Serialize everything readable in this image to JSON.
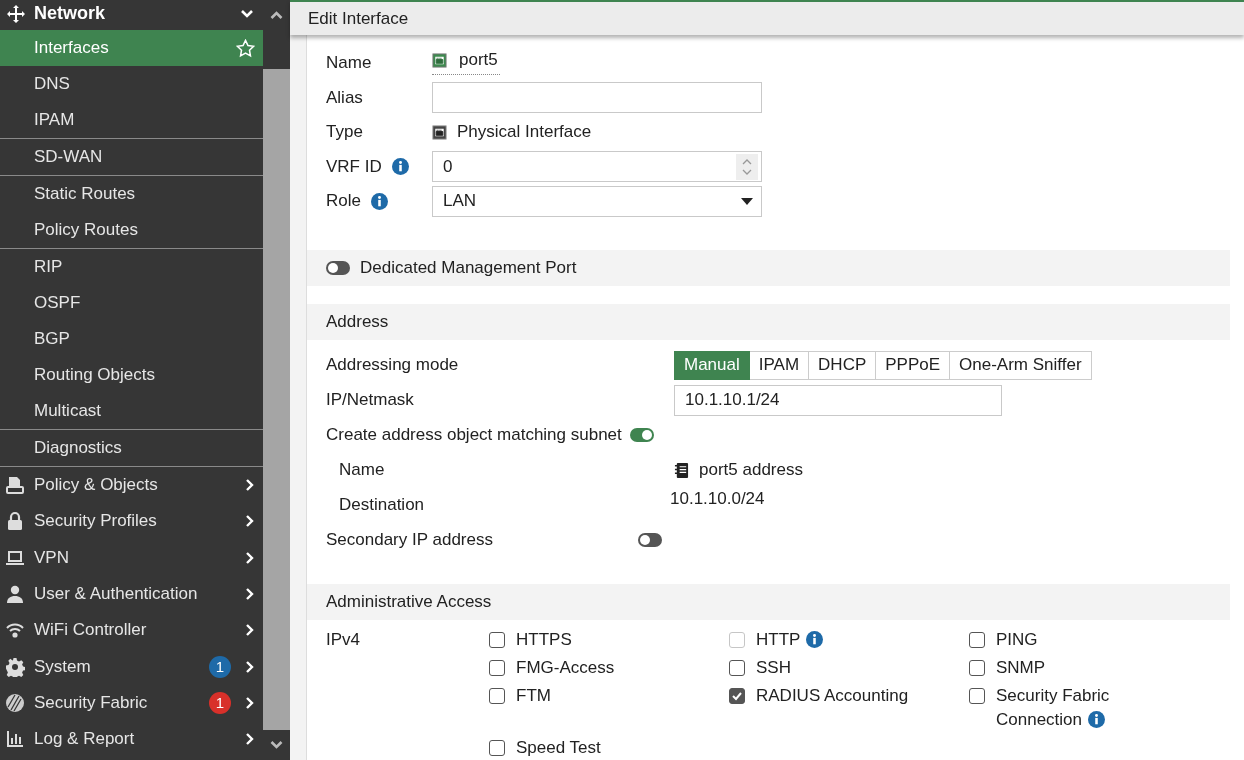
{
  "sidebar": {
    "header": {
      "label": "Network",
      "expanded": true
    },
    "groups": [
      [
        {
          "label": "Interfaces",
          "selected": true
        },
        {
          "label": "DNS",
          "selected": false
        },
        {
          "label": "IPAM",
          "selected": false
        }
      ],
      [
        {
          "label": "SD-WAN",
          "selected": false
        }
      ],
      [
        {
          "label": "Static Routes",
          "selected": false
        },
        {
          "label": "Policy Routes",
          "selected": false
        }
      ],
      [
        {
          "label": "RIP",
          "selected": false
        },
        {
          "label": "OSPF",
          "selected": false
        },
        {
          "label": "BGP",
          "selected": false
        },
        {
          "label": "Routing Objects",
          "selected": false
        },
        {
          "label": "Multicast",
          "selected": false
        }
      ],
      [
        {
          "label": "Diagnostics",
          "selected": false
        }
      ]
    ],
    "categories": [
      {
        "kind": "policy",
        "label": "Policy & Objects"
      },
      {
        "kind": "lock",
        "label": "Security Profiles"
      },
      {
        "kind": "laptop",
        "label": "VPN"
      },
      {
        "kind": "user",
        "label": "User & Authentication"
      },
      {
        "kind": "wifi",
        "label": "WiFi Controller"
      },
      {
        "kind": "gear",
        "label": "System",
        "badge": "1",
        "color": "#1e6aa8"
      },
      {
        "kind": "fabric",
        "label": "Security Fabric",
        "badge": "1",
        "color": "#d8302a"
      },
      {
        "kind": "chart",
        "label": "Log & Report"
      }
    ]
  },
  "dialog": {
    "title": "Edit Interface",
    "name": {
      "label": "Name",
      "value": "port5"
    },
    "alias": {
      "label": "Alias"
    },
    "type": {
      "label": "Type",
      "value": "Physical Interface"
    },
    "vrf": {
      "label": "VRF ID",
      "value": "0"
    },
    "role": {
      "label": "Role",
      "value": "LAN"
    },
    "dedicated": {
      "label": "Dedicated Management Port",
      "on": false
    },
    "address": {
      "title": "Address",
      "mode_label": "Addressing mode",
      "modes": [
        {
          "label": "Manual",
          "selected": true
        },
        {
          "label": "IPAM",
          "selected": false
        },
        {
          "label": "DHCP",
          "selected": false
        },
        {
          "label": "PPPoE",
          "selected": false
        },
        {
          "label": "One-Arm Sniffer",
          "selected": false
        }
      ],
      "ip_label": "IP/Netmask",
      "ip_value": "10.1.10.1/24",
      "create": {
        "label": "Create address object matching subnet",
        "on": true
      },
      "obj_name_label": "Name",
      "obj_name": "port5 address",
      "dest_label": "Destination",
      "dest": "10.1.10.0/24",
      "secondary": {
        "label": "Secondary IP address",
        "on": false
      }
    },
    "admin": {
      "title": "Administrative Access",
      "ipv4_label": "IPv4",
      "options": [
        {
          "label": "HTTPS",
          "checked": false,
          "disabled": false,
          "info": false
        },
        {
          "label": "HTTP",
          "checked": false,
          "disabled": true,
          "info": true
        },
        {
          "label": "PING",
          "checked": false,
          "disabled": false,
          "info": false
        },
        {
          "label": "FMG-Access",
          "checked": false,
          "disabled": false,
          "info": false
        },
        {
          "label": "SSH",
          "checked": false,
          "disabled": false,
          "info": false
        },
        {
          "label": "SNMP",
          "checked": false,
          "disabled": false,
          "info": false
        },
        {
          "label": "FTM",
          "checked": false,
          "disabled": false,
          "info": false
        },
        {
          "label": "RADIUS Accounting",
          "checked": true,
          "disabled": false,
          "info": false
        },
        {
          "label": "Security Fabric Connection",
          "checked": false,
          "disabled": false,
          "info": true
        },
        {
          "label": "Speed Test",
          "checked": false,
          "disabled": false,
          "info": false
        }
      ]
    }
  }
}
